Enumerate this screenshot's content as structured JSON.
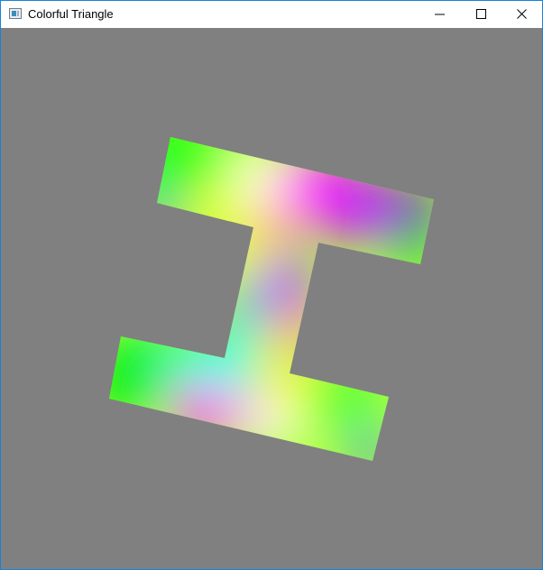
{
  "window": {
    "title": "Colorful Triangle",
    "icon": "app-window-icon",
    "controls": [
      {
        "name": "minimize",
        "icon": "minimize-icon"
      },
      {
        "name": "maximize",
        "icon": "maximize-icon"
      },
      {
        "name": "close",
        "icon": "close-icon"
      }
    ]
  },
  "scene": {
    "background_color": "#808080",
    "shape": "I-beam",
    "vertex_colors": [
      "#00ff00",
      "#ffff00",
      "#ffffff",
      "#ff00ff",
      "#8000ff",
      "#00ffff",
      "#4060ff",
      "#ff8080"
    ]
  }
}
